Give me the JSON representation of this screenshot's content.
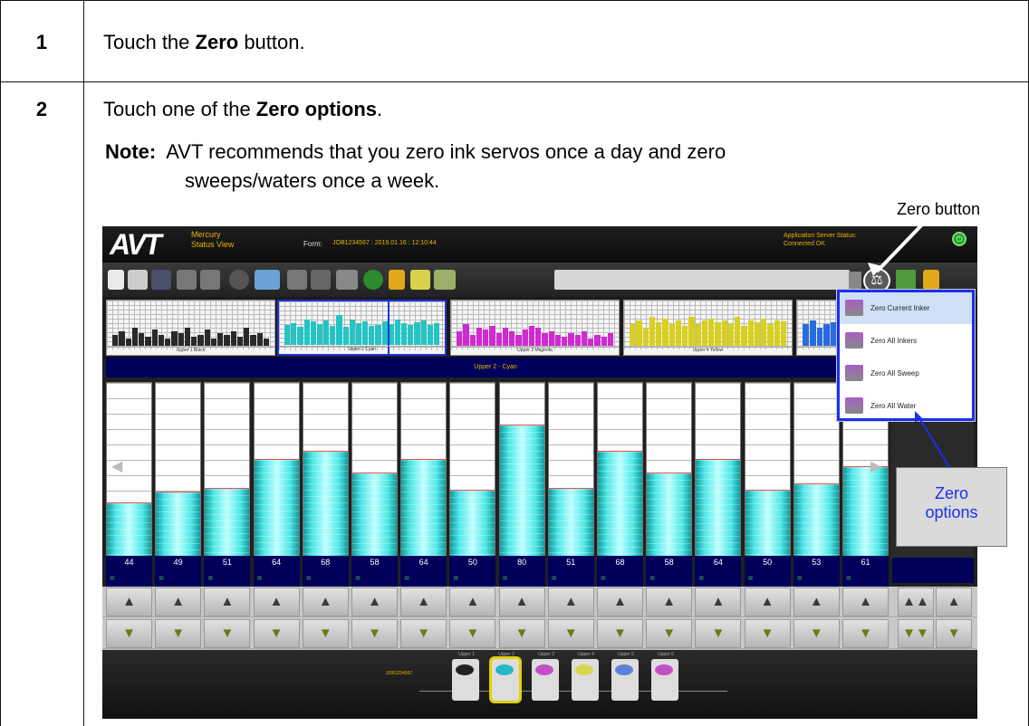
{
  "steps": [
    {
      "number": "1",
      "pre": "Touch the ",
      "bold": "Zero",
      "post": " button."
    },
    {
      "number": "2",
      "pre": "Touch one of the ",
      "bold": "Zero options",
      "post": "."
    }
  ],
  "note": {
    "label": "Note:",
    "line1": "AVT recommends that you zero ink servos once a day and zero",
    "line2": "sweeps/waters once a week."
  },
  "callouts": {
    "zero_button": "Zero button",
    "zero_options_l1": "Zero",
    "zero_options_l2": "options"
  },
  "screen": {
    "logo": "AVT",
    "app_name_l1": "Mercury",
    "app_name_l2": "Status View",
    "form_label": "Form:",
    "form_value": "JOB1234567 : 2019.01.16 : 12:10:44",
    "app_status_l1": "Application Server Status:",
    "app_status_l2": "Connected OK",
    "zero_icon": "zero-inker-icon",
    "units": [
      {
        "label": "Upper 1 Black",
        "color": "#2a2a2a",
        "heights": [
          0.3,
          0.4,
          0.2,
          0.5,
          0.35,
          0.25,
          0.45,
          0.3,
          0.2,
          0.4,
          0.35,
          0.5,
          0.25,
          0.3,
          0.45,
          0.2,
          0.35,
          0.3,
          0.4,
          0.25,
          0.5,
          0.3,
          0.35,
          0.2
        ]
      },
      {
        "label": "Upper 2 Cyan",
        "color": "#24c4c4",
        "heights": [
          0.55,
          0.6,
          0.5,
          0.7,
          0.65,
          0.58,
          0.68,
          0.52,
          0.82,
          0.5,
          0.7,
          0.6,
          0.66,
          0.52,
          0.56,
          0.64,
          0.58,
          0.7,
          0.6,
          0.54,
          0.62,
          0.68,
          0.55,
          0.6
        ]
      },
      {
        "label": "Upper 3 Magenta",
        "color": "#d02ad0",
        "heights": [
          0.4,
          0.6,
          0.3,
          0.5,
          0.45,
          0.55,
          0.35,
          0.5,
          0.4,
          0.3,
          0.45,
          0.55,
          0.5,
          0.35,
          0.4,
          0.3,
          0.25,
          0.35,
          0.3,
          0.4,
          0.2,
          0.3,
          0.25,
          0.35
        ]
      },
      {
        "label": "Upper 4 Yellow",
        "color": "#d8d020",
        "heights": [
          0.6,
          0.7,
          0.5,
          0.8,
          0.65,
          0.75,
          0.6,
          0.7,
          0.55,
          0.8,
          0.6,
          0.7,
          0.75,
          0.65,
          0.7,
          0.6,
          0.8,
          0.55,
          0.7,
          0.65,
          0.75,
          0.6,
          0.7,
          0.68
        ]
      },
      {
        "label": "",
        "color": "#2a6be0",
        "heights": [
          0.6,
          0.7,
          0.5,
          0.6,
          0.65,
          0.55
        ]
      }
    ],
    "title_bar": "Upper 2 - Cyan",
    "columns": [
      44,
      49,
      51,
      64,
      68,
      58,
      64,
      50,
      80,
      51,
      68,
      58,
      64,
      50,
      53,
      61
    ],
    "bottom_label": "JOB1234567",
    "tray": [
      {
        "caption": "Upper 1",
        "dot": "#222"
      },
      {
        "caption": "Upper 2",
        "dot": "#29b6c6"
      },
      {
        "caption": "Upper 3",
        "dot": "#c44fc4"
      },
      {
        "caption": "Upper 4",
        "dot": "#d8d450"
      },
      {
        "caption": "Upper 5",
        "dot": "#5a82d6"
      },
      {
        "caption": "Upper 6",
        "dot": "#c44fc4"
      }
    ],
    "dropdown": [
      {
        "label": "Zero Current Inker",
        "icon": "zero-current-inker-icon"
      },
      {
        "label": "Zero All Inkers",
        "icon": "zero-all-inkers-icon"
      },
      {
        "label": "Zero All Sweep",
        "icon": "zero-all-sweep-icon"
      },
      {
        "label": "Zero All Water",
        "icon": "zero-all-water-icon"
      }
    ]
  }
}
